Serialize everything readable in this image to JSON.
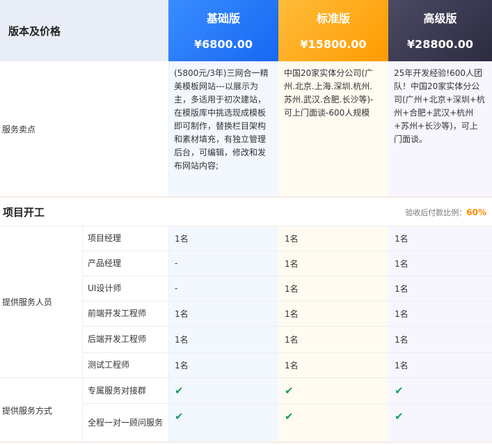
{
  "header": {
    "label": "版本及价格",
    "plans": [
      {
        "name": "基础版",
        "price": "¥6800.00"
      },
      {
        "name": "标准版",
        "price": "¥15800.00"
      },
      {
        "name": "高级版",
        "price": "¥28800.00"
      }
    ]
  },
  "features": {
    "label": "服务卖点",
    "basic": "(5800元/3年)三网合一精美模板网站---以展示为主，多适用于初次建站，在模版库中挑选现成模板即可制作，替换栏目架构和素材填充，有独立管理后台，可编辑，修改和发布网站内容;",
    "standard": "中国20家实体分公司(广州.北京.上海.深圳.杭州.苏州.武汉.合肥.长沙等)-可上门面谈-600人规模",
    "premium": "25年开发经验!600人团队！中国20家实体分公司(广州+北京+深圳+杭州+合肥+武汉+杭州+苏州+长沙等)，可上门面谈。"
  },
  "section": {
    "title": "项目开工",
    "ratio_label": "验收后付款比例：",
    "ratio_value": "60%"
  },
  "staff": {
    "label": "提供服务人员",
    "rows": [
      {
        "role": "项目经理",
        "basic": "1名",
        "standard": "1名",
        "premium": "1名"
      },
      {
        "role": "产品经理",
        "basic": "-",
        "standard": "1名",
        "premium": "1名"
      },
      {
        "role": "UI设计师",
        "basic": "-",
        "standard": "1名",
        "premium": "1名"
      },
      {
        "role": "前端开发工程师",
        "basic": "1名",
        "standard": "1名",
        "premium": "1名"
      },
      {
        "role": "后端开发工程师",
        "basic": "1名",
        "standard": "1名",
        "premium": "1名"
      },
      {
        "role": "测试工程师",
        "basic": "1名",
        "standard": "1名",
        "premium": "1名"
      }
    ]
  },
  "service": {
    "label": "提供服务方式",
    "check_glyph": "✔",
    "rows": [
      {
        "method": "专属服务对接群",
        "basic": true,
        "standard": true,
        "premium": true
      },
      {
        "method": "全程一对一顾问服务",
        "basic": true,
        "standard": true,
        "premium": true
      }
    ]
  },
  "colors": {
    "basic": "#1767f2",
    "standard": "#ff9b00",
    "premium": "#2c2b40",
    "accent": "#ff8a00",
    "check": "#1a9c5f"
  }
}
